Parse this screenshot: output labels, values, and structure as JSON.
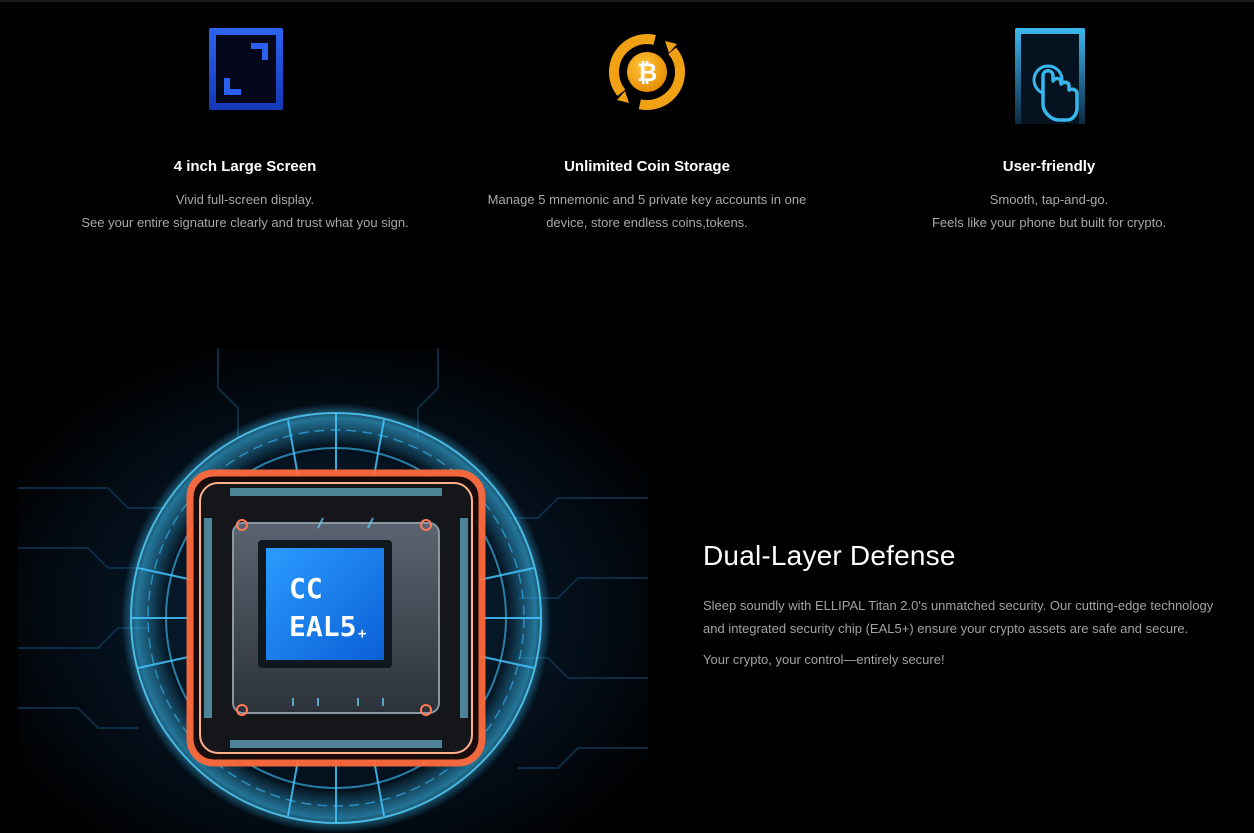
{
  "features": [
    {
      "icon": "large-screen-icon",
      "title": "4 inch Large Screen",
      "line1": "Vivid full-screen display.",
      "line2": "See your entire signature clearly and trust what you sign."
    },
    {
      "icon": "bitcoin-cycle-icon",
      "title": "Unlimited Coin Storage",
      "line1": "Manage 5 mnemonic and 5 private key accounts in one",
      "line2": "device, store endless coins,tokens."
    },
    {
      "icon": "touch-hand-icon",
      "title": "User-friendly",
      "line1": "Smooth, tap-and-go.",
      "line2": "Feels like your phone but built for crypto."
    }
  ],
  "chip": {
    "line1": "CC",
    "line2": "EAL5",
    "plus": "+"
  },
  "defense": {
    "title": "Dual-Layer Defense",
    "paragraph1": "Sleep soundly with ELLIPAL Titan 2.0's unmatched security. Our cutting-edge technology and integrated security chip (EAL5+)  ensure your crypto assets are safe and secure.",
    "paragraph2": "Your crypto, your control—entirely secure!"
  },
  "colors": {
    "background": "#000000",
    "screen_icon_blue": "#1f4fd8",
    "bitcoin_orange": "#f2a20c",
    "touch_icon_cyan": "#35b6f2",
    "chip_glow_cyan": "#3ec8ff",
    "chip_glow_orange": "#ff6a3c"
  }
}
